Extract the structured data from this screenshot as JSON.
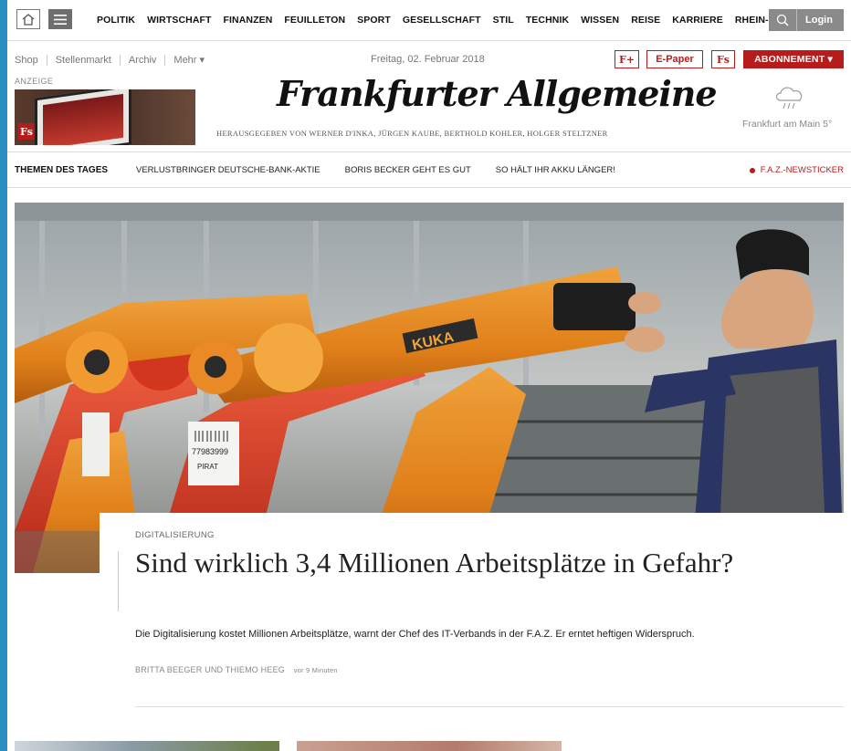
{
  "nav": {
    "home_icon": "home-icon",
    "menu_icon": "hamburger-menu-icon",
    "items": [
      "POLITIK",
      "WIRTSCHAFT",
      "FINANZEN",
      "FEUILLETON",
      "SPORT",
      "GESELLSCHAFT",
      "STIL",
      "TECHNIK",
      "WISSEN",
      "REISE",
      "KARRIERE",
      "RHEIN-MAIN"
    ],
    "search_icon": "search-icon",
    "login_label": "Login"
  },
  "subnav": {
    "links": [
      "Shop",
      "Stellenmarkt",
      "Archiv",
      "Mehr ▾"
    ],
    "date": "Freitag, 02. Februar 2018",
    "fplus_label": "F+",
    "epaper_label": "E-Paper",
    "fs_label": "Fs",
    "abo_label": "ABONNEMENT ▾"
  },
  "ad": {
    "label": "ANZEIGE",
    "logo_text": "Fs"
  },
  "masthead": {
    "title": "Frankfurter Allgemeine",
    "publisher": "HERAUSGEGEBEN VON WERNER D'INKA, JÜRGEN KAUBE, BERTHOLD KOHLER, HOLGER STELTZNER"
  },
  "weather": {
    "icon": "cloud-rain-icon",
    "city_temp": "Frankfurt am Main 5°"
  },
  "themen": {
    "title": "THEMEN DES TAGES",
    "links": [
      "VERLUSTBRINGER DEUTSCHE-BANK-AKTIE",
      "BORIS BECKER GEHT ES GUT",
      "SO HÄLT IHR AKKU LÄNGER!"
    ],
    "newsticker": "F.A.Z.-NEWSTICKER"
  },
  "hero": {
    "robot_label": "KUKA",
    "tag_number": "77983999",
    "tag_text": "PIRAT"
  },
  "article": {
    "kicker": "DIGITALISIERUNG",
    "headline": "Sind wirklich 3,4 Millionen Arbeitsplätze in Gefahr?",
    "teaser": "Die Digitalisierung kostet Millionen Arbeitsplätze, warnt der Chef des IT-Verbands in der F.A.Z. Er erntet heftigen Widerspruch.",
    "authors": "BRITTA BEEGER UND THIEMO HEEG",
    "time": "vor 9 Minuten"
  },
  "colors": {
    "brand_red": "#b71c1c",
    "frame_blue": "#2b8fc4"
  }
}
